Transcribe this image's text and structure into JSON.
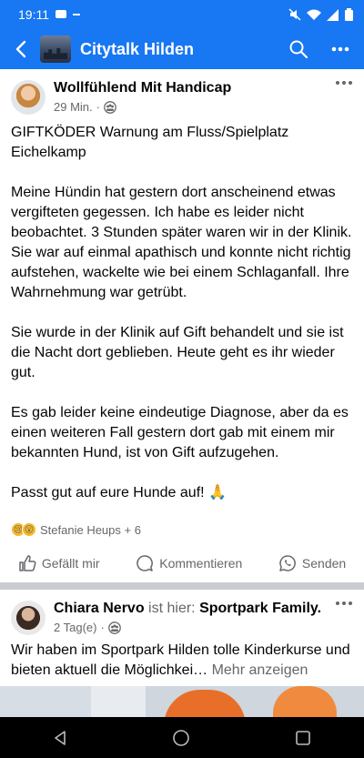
{
  "status_bar": {
    "time": "19:11"
  },
  "app_bar": {
    "title": "Citytalk Hilden"
  },
  "posts": [
    {
      "author": "Wollfühlend Mit Handicap",
      "time": "29 Min.",
      "paragraphs": [
        "GIFTKÖDER Warnung  am Fluss/Spielplatz Eichelkamp",
        "Meine Hündin hat gestern dort anscheinend etwas vergifteten gegessen. Ich habe es leider nicht beobachtet. 3 Stunden später waren wir in der Klinik.  Sie war auf einmal apathisch und konnte nicht richtig aufstehen,  wackelte wie bei einem Schlaganfall. Ihre Wahrnehmung war getrübt.",
        "Sie wurde in der Klinik auf Gift behandelt und sie ist die Nacht dort geblieben.  Heute geht es ihr wieder gut.",
        "Es gab leider keine eindeutige Diagnose,  aber da es einen weiteren Fall gestern dort gab mit einem mir bekannten Hund,  ist von Gift aufzugehen.",
        "Passt gut auf eure Hunde auf! 🙏"
      ],
      "reactions_text": "Stefanie Heups + 6",
      "actions": {
        "like": "Gefällt mir",
        "comment": "Kommentieren",
        "share": "Senden"
      }
    },
    {
      "author": "Chiara Nervo",
      "is_here": "ist hier:",
      "place": "Sportpark Family.",
      "time": "2 Tag(e)",
      "text": "Wir haben im Sportpark Hilden tolle Kinderkurse und bieten aktuell die Möglichkei…",
      "more_label": "Mehr anzeigen"
    }
  ],
  "colors": {
    "brand": "#1877f2",
    "muted": "#65676b",
    "separator": "#c9ccd1"
  }
}
